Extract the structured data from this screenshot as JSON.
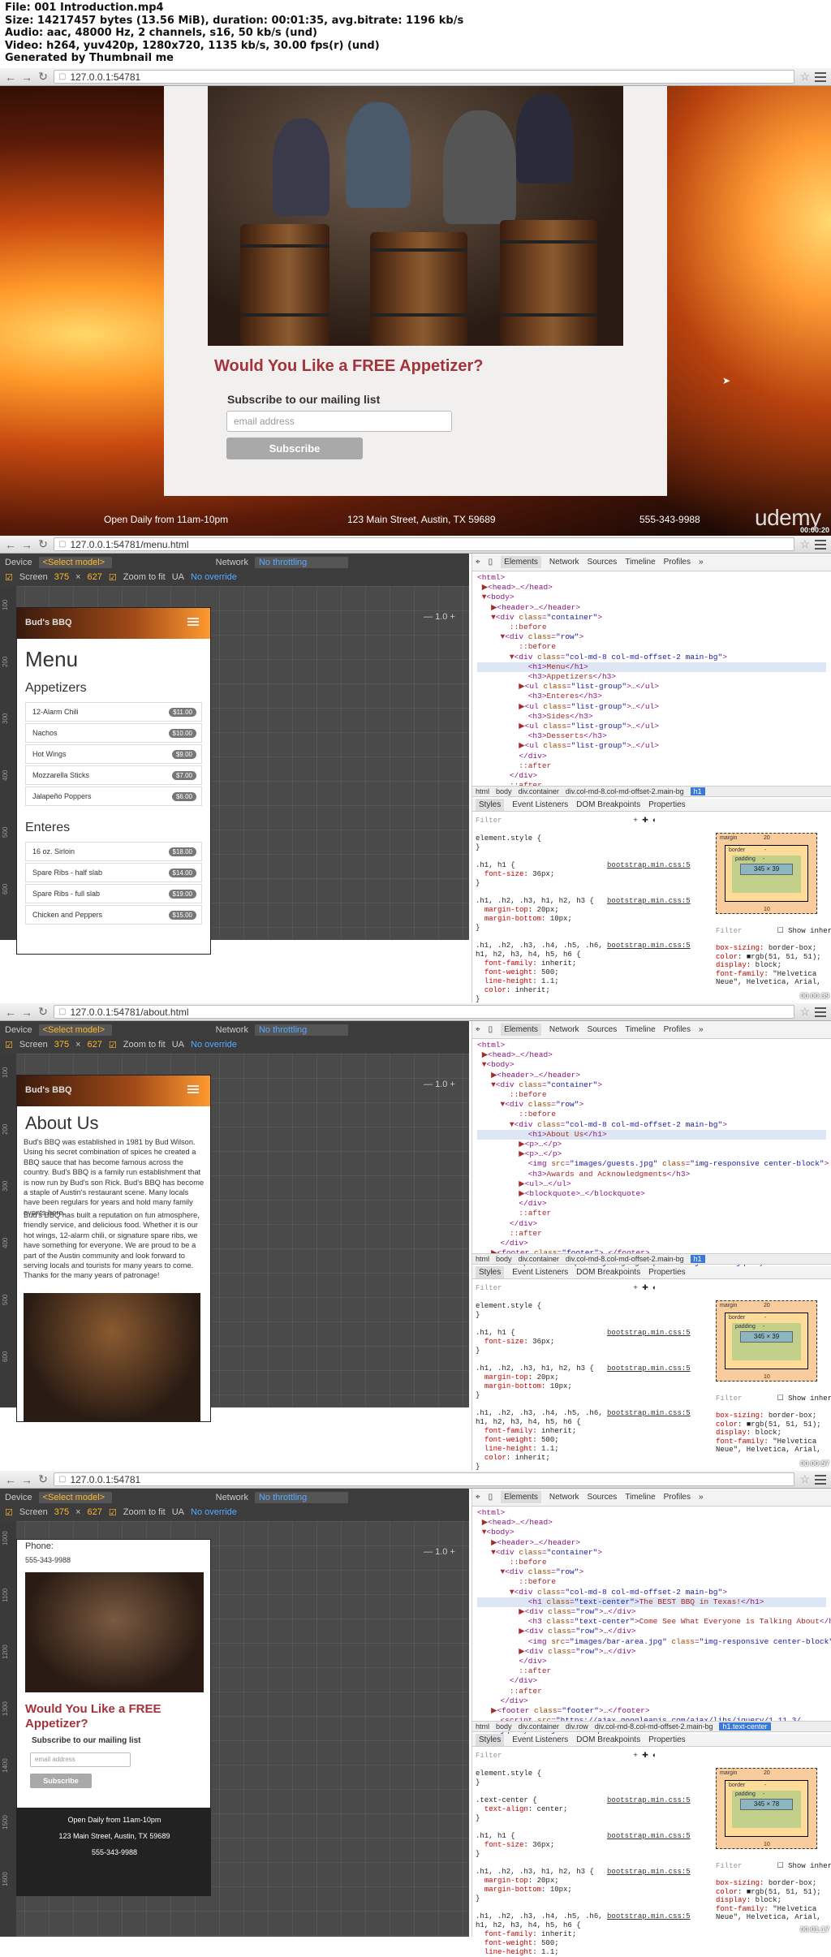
{
  "info": {
    "lines": [
      "File: 001 Introduction.mp4",
      "Size: 14217457 bytes (13.56 MiB), duration: 00:01:35, avg.bitrate: 1196 kb/s",
      "Audio: aac, 48000 Hz, 2 channels, s16, 50 kb/s (und)",
      "Video: h264, yuv420p, 1280x720, 1135 kb/s, 30.00 fps(r) (und)",
      "Generated by Thumbnail me"
    ]
  },
  "frame1": {
    "url": "127.0.0.1:54781",
    "heading": "Would You Like a FREE Appetizer?",
    "subscribe_label": "Subscribe to our mailing list",
    "email_placeholder": "email address",
    "button": "Subscribe",
    "hours": "Open Daily from 11am-10pm",
    "address": "123 Main Street, Austin, TX 59689",
    "phone": "555-343-9988",
    "logo": "udemy",
    "timestamp": "00:00:20"
  },
  "devtools": {
    "device": "Device",
    "model": "<Select model>",
    "network": "Network",
    "throttle": "No throttling",
    "screen": "Screen",
    "w": "375",
    "h": "627",
    "zoom": "Zoom to fit",
    "ua": "UA",
    "ua_val": "No override",
    "zoom_val": "1.0",
    "tabs": [
      "Elements",
      "Network",
      "Sources",
      "Timeline",
      "Profiles",
      "»"
    ],
    "sub_tabs": [
      "Styles",
      "Event Listeners",
      "DOM Breakpoints",
      "Properties"
    ],
    "filter": "Filter",
    "show_inherited": "Show inherited",
    "brand": "Bud's BBQ"
  },
  "frame2": {
    "url": "127.0.0.1:54781/menu.html",
    "title": "Menu",
    "sections": [
      {
        "name": "Appetizers",
        "items": [
          [
            "12-Alarm Chili",
            "$11.00"
          ],
          [
            "Nachos",
            "$10.00"
          ],
          [
            "Hot Wings",
            "$9.00"
          ],
          [
            "Mozzarella Sticks",
            "$7.00"
          ],
          [
            "Jalapeño Poppers",
            "$6.00"
          ]
        ]
      },
      {
        "name": "Enteres",
        "items": [
          [
            "16 oz. Sirloin",
            "$18.00"
          ],
          [
            "Spare Ribs - half slab",
            "$14.00"
          ],
          [
            "Spare Ribs - full slab",
            "$19.00"
          ],
          [
            "Chicken and Peppers",
            "$15.00"
          ]
        ]
      }
    ],
    "crumbs": [
      "html",
      "body",
      "div.container",
      "div.col-md-8.col-md-offset-2.main-bg",
      "h1"
    ],
    "timestamp": "00:00:39"
  },
  "frame3": {
    "url": "127.0.0.1:54781/about.html",
    "title": "About Us",
    "p1": "Bud's BBQ was established in 1981 by Bud Wilson. Using his secret combination of spices he created a BBQ sauce that has become famous across the country. Bud's BBQ is a family run establishment that is now run by Bud's son Rick. Bud's BBQ has become a staple of Austin's restaurant scene. Many locals have been regulars for years and hold many family events here.",
    "p2": "Bud's BBQ has built a reputation on fun atmosphere, friendly service, and delicious food. Whether it is our hot wings, 12-alarm chili, or signature spare ribs, we have something for everyone. We are proud to be a part of the Austin community and look forward to serving locals and tourists for many years to come. Thanks for the many years of patronage!",
    "crumbs": [
      "html",
      "body",
      "div.container",
      "div.col-md-8.col-md-offset-2.main-bg",
      "h1"
    ],
    "timestamp": "00:00:57"
  },
  "frame4": {
    "url": "127.0.0.1:54781",
    "phone_label": "Phone:",
    "phone": "555-343-9988",
    "heading": "Would You Like a FREE Appetizer?",
    "subscribe_label": "Subscribe to our mailing list",
    "email_placeholder": "email address",
    "button": "Subscribe",
    "hours": "Open Daily from 11am-10pm",
    "address": "123 Main Street, Austin, TX 59689",
    "crumbs": [
      "html",
      "body",
      "div.container",
      "div.row",
      "div.col-md-8.col-md-offset-2.main-bg",
      "h1.text-center"
    ],
    "timestamp": "00:01:17"
  },
  "box": {
    "margin": "20",
    "border": "-",
    "padding": "-",
    "size1": "345 × 39",
    "size4": "345 × 78",
    "bottom": "10"
  }
}
